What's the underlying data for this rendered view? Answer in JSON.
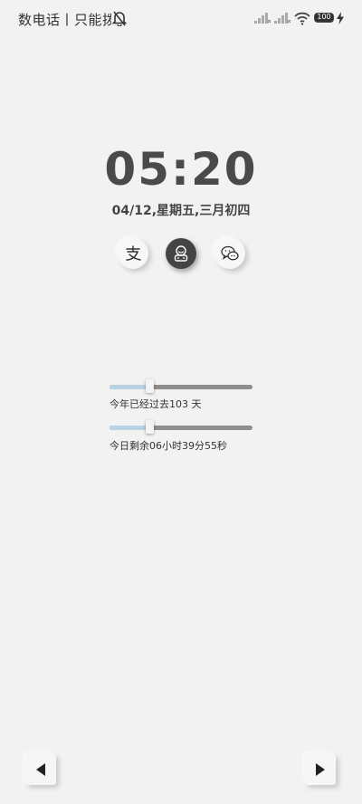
{
  "status_bar": {
    "text": "数电话丨只能拨打",
    "battery": "100",
    "icons": [
      "bell-off-icon",
      "signal-icon",
      "signal-icon",
      "wifi-icon",
      "battery-icon",
      "charging-icon"
    ]
  },
  "clock": {
    "time": "05:20",
    "date": "04/12,星期五,三月初四"
  },
  "shortcuts": [
    {
      "icon": "alipay-icon"
    },
    {
      "icon": "assistant-robot-icon"
    },
    {
      "icon": "wechat-icon"
    }
  ],
  "progress": {
    "year": {
      "label": "今年已经过去103 天",
      "fraction": 0.28
    },
    "day": {
      "label": "今日剩余06小时39分55秒",
      "fraction": 0.28
    }
  },
  "colors": {
    "background": "#f2f2f2",
    "progress_fill": "#b9d2e4",
    "progress_track": "#8e8e8e",
    "dark_button": "#444444"
  },
  "navigation": {
    "prev_icon": "triangle-left-icon",
    "next_icon": "triangle-right-icon"
  }
}
